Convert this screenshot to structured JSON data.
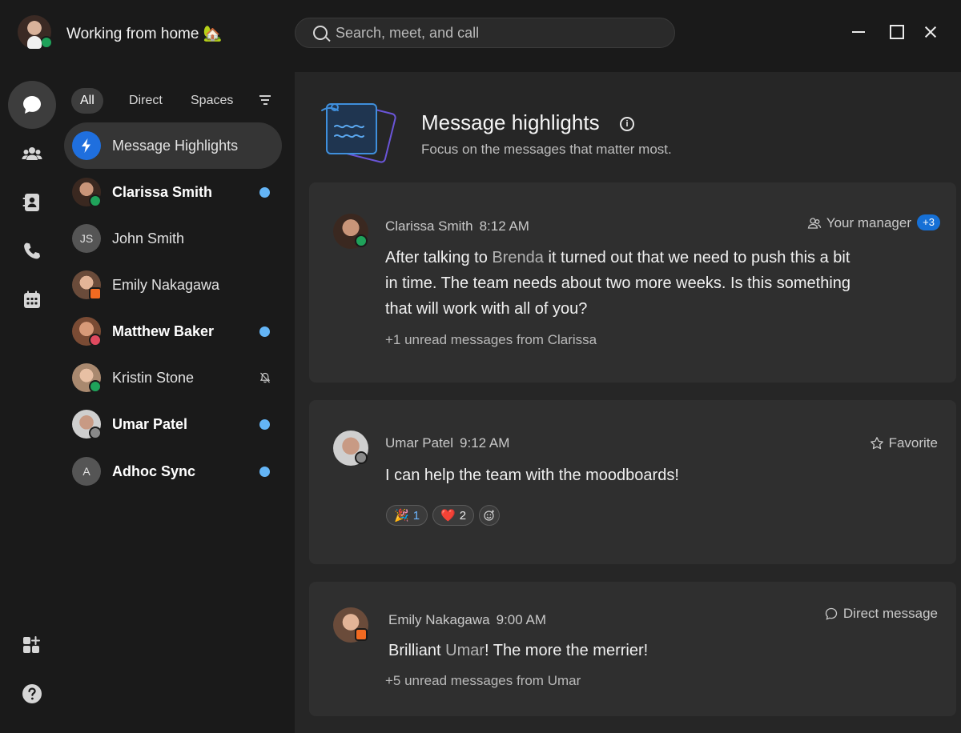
{
  "titlebar": {
    "status_text": "Working from home 🏡",
    "search_placeholder": "Search, meet, and call"
  },
  "rail": {
    "items": [
      "messaging-icon",
      "teams-icon",
      "contacts-icon",
      "calls-icon",
      "calendar-icon"
    ],
    "bottom": [
      "apps-icon",
      "help-icon"
    ]
  },
  "filters": {
    "all": "All",
    "direct": "Direct",
    "spaces": "Spaces"
  },
  "conversations": [
    {
      "name": "Message Highlights",
      "bold": false,
      "unread": false
    },
    {
      "name": "Clarissa Smith",
      "bold": true,
      "unread": true,
      "presence": "active"
    },
    {
      "name": "John Smith",
      "initials": "JS",
      "bold": false,
      "unread": false
    },
    {
      "name": "Emily Nakagawa",
      "bold": false,
      "unread": false,
      "presence": "in-meeting"
    },
    {
      "name": "Matthew Baker",
      "bold": true,
      "unread": true,
      "presence": "do-not-disturb"
    },
    {
      "name": "Kristin Stone",
      "bold": false,
      "unread": false,
      "muted": true,
      "presence": "active"
    },
    {
      "name": "Umar Patel",
      "bold": true,
      "unread": true,
      "presence": "away"
    },
    {
      "name": "Adhoc Sync",
      "initials": "A",
      "bold": true,
      "unread": true
    }
  ],
  "main": {
    "title": "Message highlights",
    "subtitle": "Focus on the messages that matter most.",
    "cards": [
      {
        "sender": "Clarissa Smith",
        "time": "8:12 AM",
        "tag": "Your manager",
        "badge": "+3",
        "text_before": "After talking to ",
        "mention": "Brenda",
        "text_after": " it turned out that we need to push this a bit in time. The team needs about two more weeks. Is this something that will work with all of you?",
        "unread_more": "+1 unread messages from Clarissa"
      },
      {
        "sender": "Umar Patel",
        "time": "9:12 AM",
        "tag": "Favorite",
        "text": "I can help the team with the moodboards!",
        "reactions": [
          {
            "emoji": "🎉",
            "count": "1"
          },
          {
            "emoji": "❤️",
            "count": "2"
          }
        ]
      },
      {
        "sender": "Emily Nakagawa",
        "time": "9:00 AM",
        "tag": "Direct message",
        "text_before": "Brilliant ",
        "mention": "Umar",
        "text_after": "! The more the merrier!",
        "unread_more": "+5 unread messages from Umar"
      }
    ]
  },
  "colors": {
    "background": "#1a1a1a",
    "panel": "#262626",
    "card": "#2f2f2f",
    "accent_blue": "#1670d6",
    "unread_dot": "#64b5f6",
    "presence_active": "#1fa25a",
    "presence_meeting": "#f26a21",
    "presence_dnd": "#e04a5f"
  }
}
